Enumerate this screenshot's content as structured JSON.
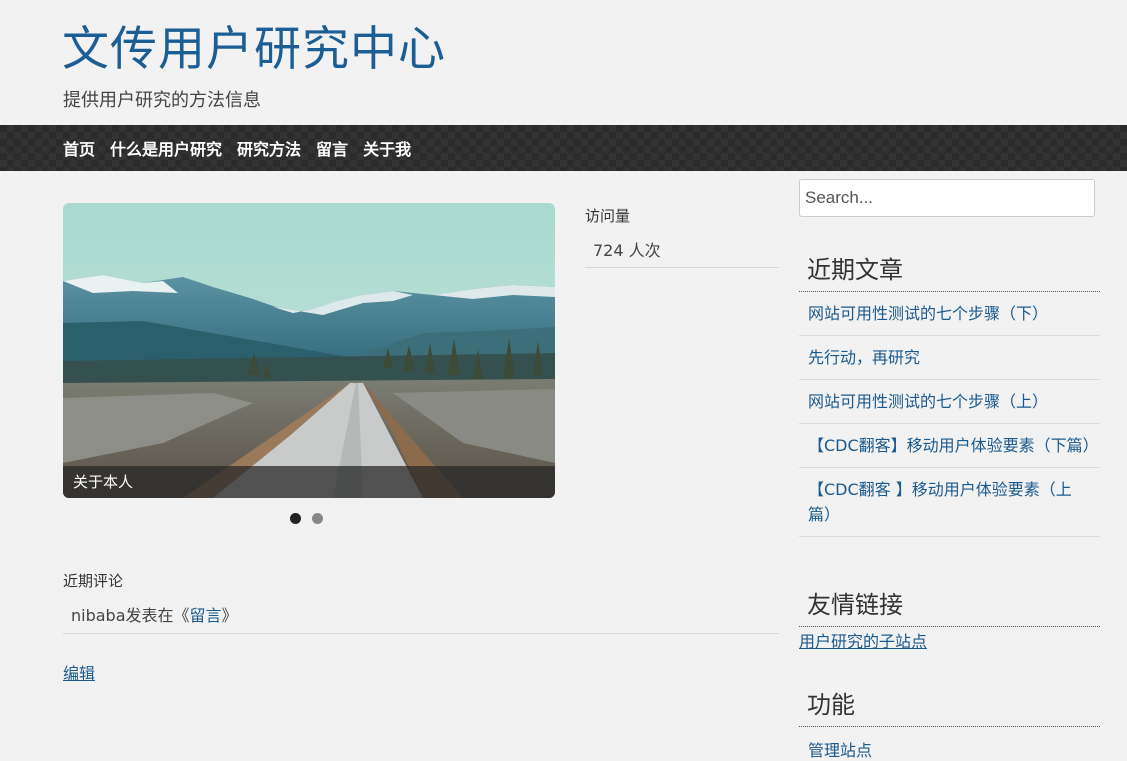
{
  "site": {
    "title": "文传用户研究中心",
    "description": "提供用户研究的方法信息"
  },
  "nav": {
    "items": [
      "首页",
      "什么是用户研究",
      "研究方法",
      "留言",
      "关于我"
    ]
  },
  "slider": {
    "caption": "关于本人",
    "dots": 2,
    "active_dot": 1
  },
  "visits": {
    "title": "访问量",
    "value": "724 人次"
  },
  "recent_comments": {
    "title": "近期评论",
    "author": "nibaba发表在《",
    "post_link": "留言",
    "suffix": "》"
  },
  "edit_link": "编辑",
  "sidebar": {
    "search_placeholder": "Search...",
    "recent_posts_title": "近期文章",
    "recent_posts": [
      "网站可用性测试的七个步骤（下）",
      "先行动，再研究",
      "网站可用性测试的七个步骤（上）",
      "【CDC翻客】移动用户体验要素（下篇）",
      "【CDC翻客 】移动用户体验要素（上篇）"
    ],
    "links_title": "友情链接",
    "links": [
      "用户研究的子站点"
    ],
    "meta_title": "功能",
    "meta_links": [
      "管理站点"
    ]
  },
  "colors": {
    "title": "#1b5d95",
    "link": "#1a5a8e",
    "navbar": "#2b2b2b",
    "background": "#f2f2f2"
  }
}
